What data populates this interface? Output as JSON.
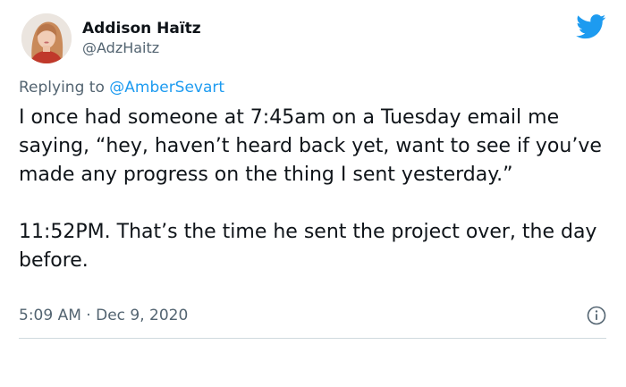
{
  "author": {
    "display_name": "Addison Haïtz",
    "handle": "@AdzHaitz"
  },
  "reply": {
    "prefix": "Replying to",
    "handle": "@AmberSevart"
  },
  "tweet": {
    "paragraph_1": "I once had someone at 7:45am on a Tuesday email me saying, “hey, haven’t heard back yet, want to see if you’ve made any progress on the thing I sent yesterday.”",
    "paragraph_2": "11:52PM. That’s the time he sent the project over, the day before."
  },
  "meta": {
    "time": "5:09 AM",
    "separator": "·",
    "date": "Dec 9, 2020"
  },
  "icons": {
    "brand": "twitter-bird-icon",
    "info": "info-icon",
    "brand_color": "#1d9bf0"
  }
}
